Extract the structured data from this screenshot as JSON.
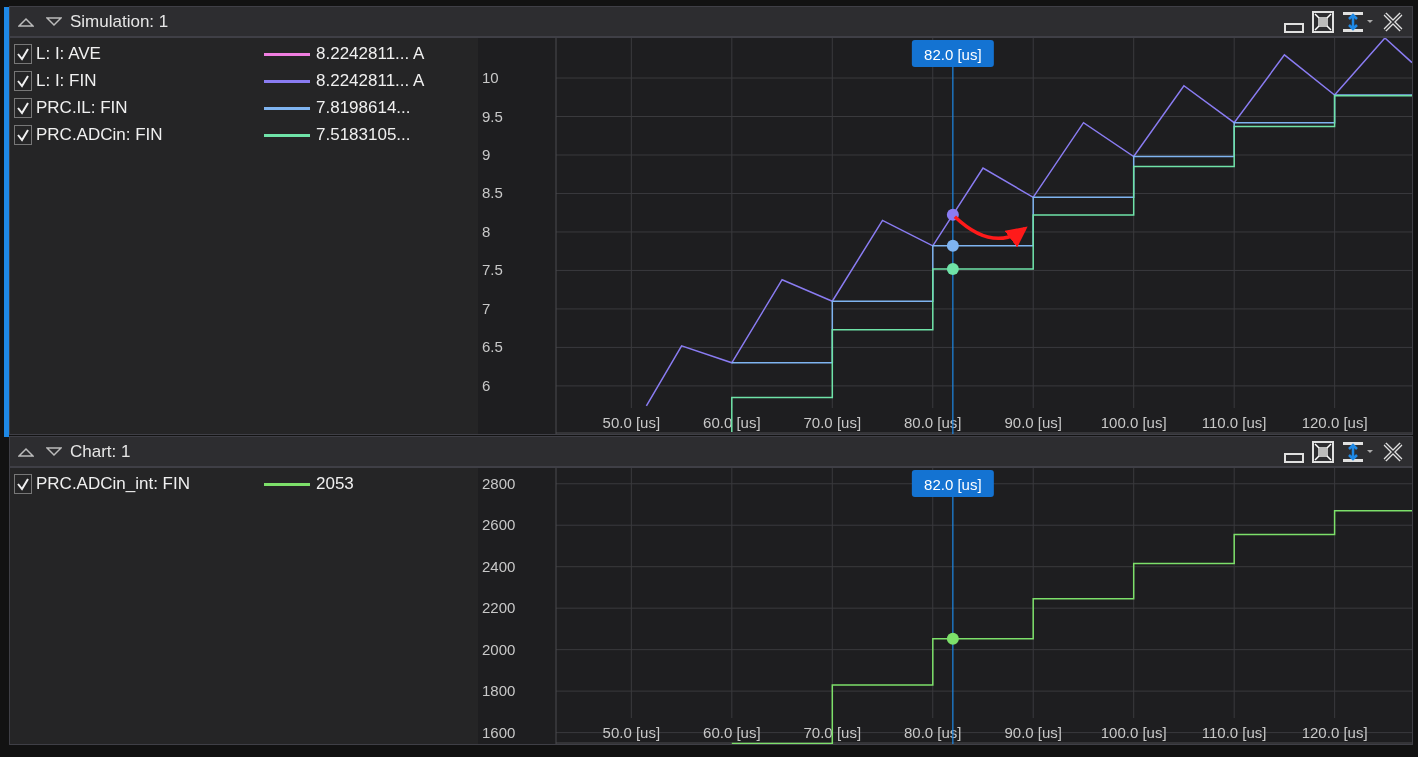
{
  "panels": [
    {
      "title": "Simulation: 1",
      "legend": [
        {
          "checked": true,
          "name": "L: I: AVE",
          "color": "#f07ee0",
          "value": "8.2242811... A"
        },
        {
          "checked": true,
          "name": "L: I: FIN",
          "color": "#8a7cf2",
          "value": "8.2242811... A"
        },
        {
          "checked": true,
          "name": "PRC.IL: FIN",
          "color": "#7fb4f0",
          "value": "7.8198614..."
        },
        {
          "checked": true,
          "name": "PRC.ADCin: FIN",
          "color": "#6fe3a8",
          "value": "7.5183105..."
        }
      ],
      "chart_data": {
        "type": "line",
        "grid": true,
        "xlim": [
          42.5,
          127.7
        ],
        "ylim": [
          5.375,
          10.52
        ],
        "xticks": [
          {
            "value": 50,
            "label": "50.0 [us]"
          },
          {
            "value": 60,
            "label": "60.0 [us]"
          },
          {
            "value": 70,
            "label": "70.0 [us]"
          },
          {
            "value": 80,
            "label": "80.0 [us]"
          },
          {
            "value": 90,
            "label": "90.0 [us]"
          },
          {
            "value": 100,
            "label": "100.0 [us]"
          },
          {
            "value": 110,
            "label": "110.0 [us]"
          },
          {
            "value": 120,
            "label": "120.0 [us]"
          }
        ],
        "yticks": [
          {
            "value": 6,
            "label": "6"
          },
          {
            "value": 6.5,
            "label": "6.5"
          },
          {
            "value": 7,
            "label": "7"
          },
          {
            "value": 7.5,
            "label": "7.5"
          },
          {
            "value": 8,
            "label": "8"
          },
          {
            "value": 8.5,
            "label": "8.5"
          },
          {
            "value": 9,
            "label": "9"
          },
          {
            "value": 9.5,
            "label": "9.5"
          },
          {
            "value": 10,
            "label": "10"
          }
        ],
        "series": [
          {
            "color": "#8a7cf2",
            "x": [
              51.5,
              55,
              60,
              65,
              70,
              75,
              80,
              85,
              90,
              95,
              100,
              105,
              110,
              115,
              120,
              125,
              127.7
            ],
            "values": [
              5.74,
              6.52,
              6.3,
              7.38,
              7.1,
              8.15,
              7.82,
              8.83,
              8.45,
              9.42,
              8.98,
              9.9,
              9.42,
              10.3,
              9.78,
              10.52,
              10.2
            ]
          },
          {
            "color": "#7fb4f0",
            "x": [
              60,
              70,
              70,
              80,
              80,
              90,
              90,
              100,
              100,
              110,
              110,
              120,
              120,
              127.7
            ],
            "values": [
              6.3,
              6.3,
              7.1,
              7.1,
              7.82,
              7.82,
              8.45,
              8.45,
              8.98,
              8.98,
              9.42,
              9.42,
              9.78,
              9.78
            ]
          },
          {
            "color": "#6fe3a8",
            "x": [
              60,
              60,
              70,
              70,
              80,
              80,
              90,
              90,
              100,
              100,
              110,
              110,
              120,
              120,
              127.7
            ],
            "values": [
              5.4,
              5.85,
              5.85,
              6.73,
              6.73,
              7.52,
              7.52,
              8.22,
              8.22,
              8.85,
              8.85,
              9.37,
              9.37,
              9.77,
              9.77
            ]
          }
        ],
        "ref_lines": [
          {
            "axis": "x",
            "value": 82,
            "label": "82.0 [us]"
          }
        ]
      }
    },
    {
      "title": "Chart: 1",
      "legend": [
        {
          "checked": true,
          "name": "PRC.ADCin_int: FIN",
          "color": "#7de06a",
          "value": "2053"
        }
      ],
      "chart_data": {
        "type": "line",
        "grid": true,
        "xlim": [
          42.5,
          127.7
        ],
        "ylim": [
          1545,
          2876
        ],
        "xticks": [
          {
            "value": 50,
            "label": "50.0 [us]"
          },
          {
            "value": 60,
            "label": "60.0 [us]"
          },
          {
            "value": 70,
            "label": "70.0 [us]"
          },
          {
            "value": 80,
            "label": "80.0 [us]"
          },
          {
            "value": 90,
            "label": "90.0 [us]"
          },
          {
            "value": 100,
            "label": "100.0 [us]"
          },
          {
            "value": 110,
            "label": "110.0 [us]"
          },
          {
            "value": 120,
            "label": "120.0 [us]"
          }
        ],
        "yticks": [
          {
            "value": 1600,
            "label": "1600"
          },
          {
            "value": 1800,
            "label": "1800"
          },
          {
            "value": 2000,
            "label": "2000"
          },
          {
            "value": 2200,
            "label": "2200"
          },
          {
            "value": 2400,
            "label": "2400"
          },
          {
            "value": 2600,
            "label": "2600"
          },
          {
            "value": 2800,
            "label": "2800"
          }
        ],
        "series": [
          {
            "color": "#7de06a",
            "x": [
              60,
              70,
              70,
              80,
              80,
              90,
              90,
              100,
              100,
              110,
              110,
              120,
              120,
              127.7
            ],
            "values": [
              1548,
              1548,
              1830,
              1830,
              2053,
              2053,
              2245,
              2245,
              2415,
              2415,
              2555,
              2555,
              2670,
              2670
            ]
          }
        ],
        "ref_lines": [
          {
            "axis": "x",
            "value": 82,
            "label": "82.0 [us]"
          }
        ]
      }
    }
  ]
}
